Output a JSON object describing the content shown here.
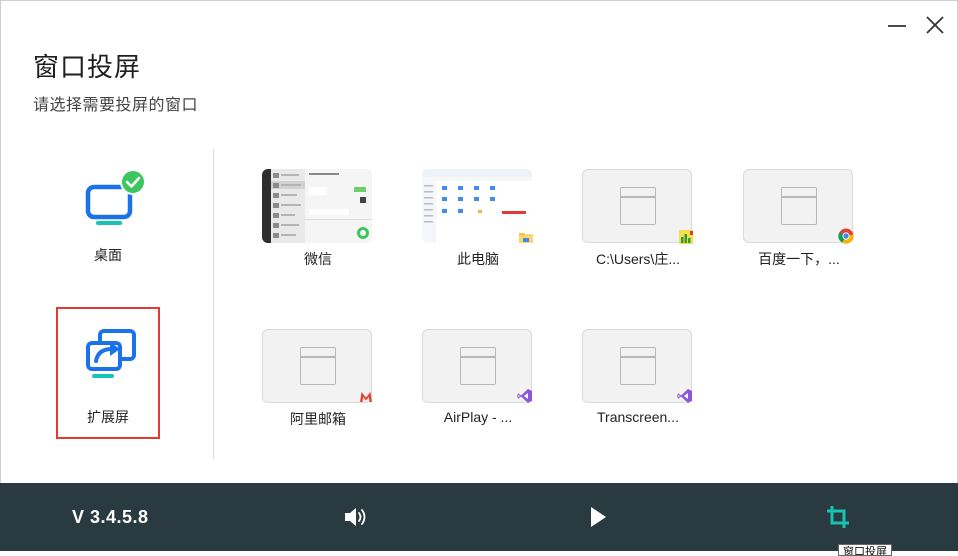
{
  "header": {
    "title": "窗口投屏",
    "subtitle": "请选择需要投屏的窗口"
  },
  "modes": {
    "desktop": {
      "label": "桌面",
      "selected": true
    },
    "extend": {
      "label": "扩展屏"
    }
  },
  "windows": [
    {
      "label": "微信",
      "thumbnail": "wechat-screenshot"
    },
    {
      "label": "此电脑",
      "thumbnail": "explorer-screenshot",
      "badge": "folder-icon"
    },
    {
      "label": "C:\\Users\\庄...",
      "thumbnail": "placeholder",
      "badge": "app-icon"
    },
    {
      "label": "百度一下，...",
      "thumbnail": "placeholder",
      "badge": "chrome-icon"
    },
    {
      "label": "阿里邮箱",
      "thumbnail": "placeholder",
      "badge": "alimail-icon"
    },
    {
      "label": "AirPlay - ...",
      "thumbnail": "placeholder",
      "badge": "visual-studio-icon"
    },
    {
      "label": "Transcreen...",
      "thumbnail": "placeholder",
      "badge": "visual-studio-icon"
    }
  ],
  "footer": {
    "version": "V 3.4.5.8",
    "tooltip": "窗口投屏"
  },
  "colors": {
    "accent": "#1a73e8",
    "teal": "#17c3b2",
    "bar_bg": "#2a3a41",
    "selected_border": "#e43a2f",
    "check_green": "#3cc65f"
  }
}
